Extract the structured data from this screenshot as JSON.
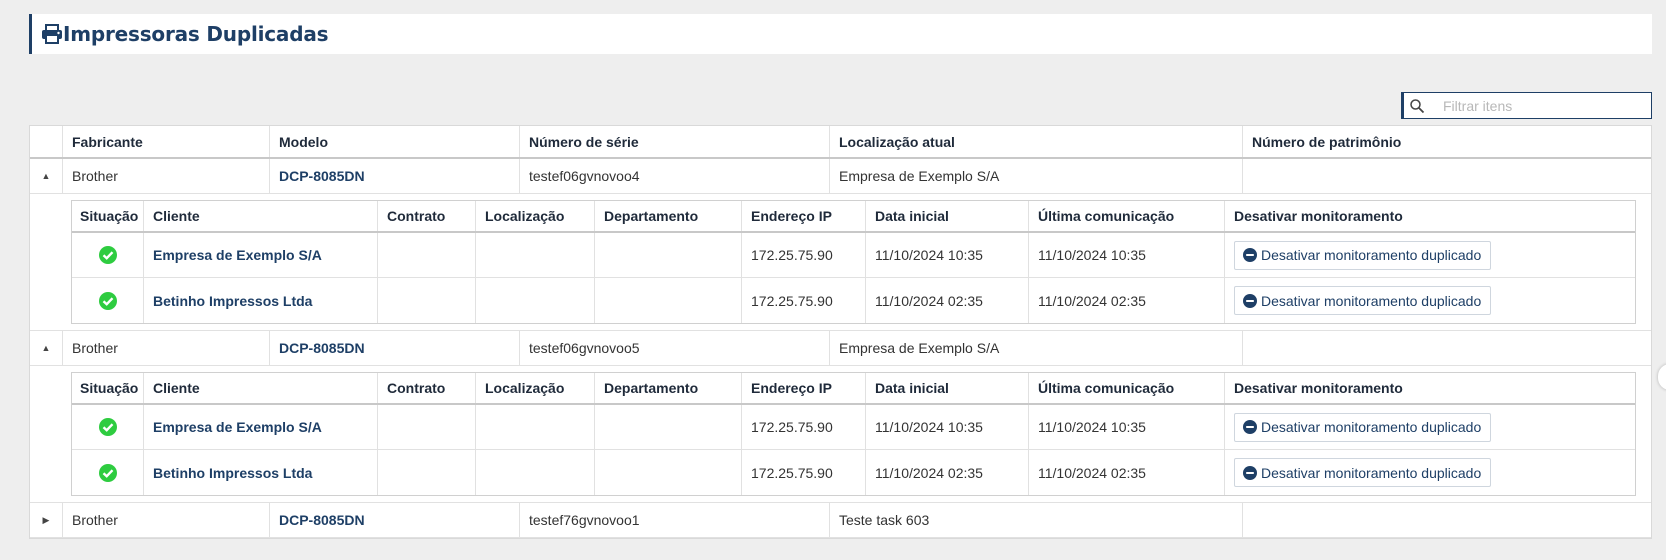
{
  "page": {
    "title": "Impressoras Duplicadas",
    "title_icon": "printer-icon"
  },
  "search": {
    "placeholder": "Filtrar itens",
    "value": "",
    "icon": "search-icon"
  },
  "colors": {
    "primary": "#1e3f66",
    "success": "#2ecc40",
    "background": "#eeeeee"
  },
  "grid": {
    "columns": [
      "",
      "Fabricante",
      "Modelo",
      "Número de série",
      "Localização atual",
      "Número de patrimônio"
    ],
    "detail_columns": [
      "Situação",
      "Cliente",
      "Contrato",
      "Localização",
      "Departamento",
      "Endereço IP",
      "Data inicial",
      "Última comunicação",
      "Desativar monitoramento"
    ],
    "rows": [
      {
        "expanded": true,
        "toggle": "▲",
        "manufacturer": "Brother",
        "model": "DCP-8085DN",
        "serial": "testef06gvnovoo4",
        "location": "Empresa de Exemplo S/A",
        "asset": "",
        "details": [
          {
            "status_icon": "check-circle-icon",
            "client": "Empresa de Exemplo S/A",
            "contract": "",
            "location": "",
            "department": "",
            "ip": "172.25.75.90",
            "start": "11/10/2024 10:35",
            "last": "11/10/2024 10:35",
            "action": "Desativar monitoramento duplicado"
          },
          {
            "status_icon": "check-circle-icon",
            "client": "Betinho Impressos Ltda",
            "contract": "",
            "location": "",
            "department": "",
            "ip": "172.25.75.90",
            "start": "11/10/2024 02:35",
            "last": "11/10/2024 02:35",
            "action": "Desativar monitoramento duplicado"
          }
        ]
      },
      {
        "expanded": true,
        "toggle": "▲",
        "manufacturer": "Brother",
        "model": "DCP-8085DN",
        "serial": "testef06gvnovoo5",
        "location": "Empresa de Exemplo S/A",
        "asset": "",
        "details": [
          {
            "status_icon": "check-circle-icon",
            "client": "Empresa de Exemplo S/A",
            "contract": "",
            "location": "",
            "department": "",
            "ip": "172.25.75.90",
            "start": "11/10/2024 10:35",
            "last": "11/10/2024 10:35",
            "action": "Desativar monitoramento duplicado"
          },
          {
            "status_icon": "check-circle-icon",
            "client": "Betinho Impressos Ltda",
            "contract": "",
            "location": "",
            "department": "",
            "ip": "172.25.75.90",
            "start": "11/10/2024 02:35",
            "last": "11/10/2024 02:35",
            "action": "Desativar monitoramento duplicado"
          }
        ]
      },
      {
        "expanded": false,
        "toggle": "▶",
        "manufacturer": "Brother",
        "model": "DCP-8085DN",
        "serial": "testef76gvnovoo1",
        "location": "Teste task 603",
        "asset": "",
        "details": []
      }
    ]
  }
}
